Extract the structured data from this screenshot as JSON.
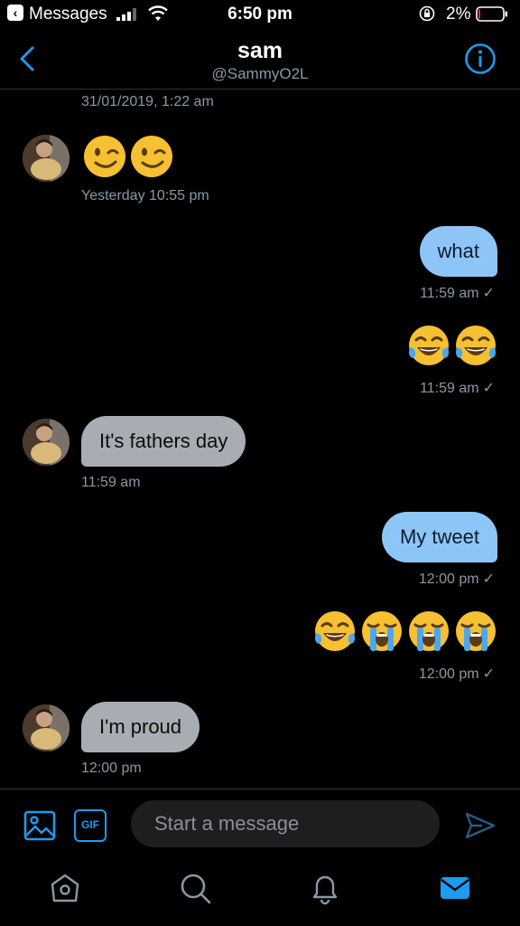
{
  "status_bar": {
    "back_app": "Messages",
    "time": "6:50 pm",
    "battery": "2%"
  },
  "header": {
    "name": "sam",
    "handle": "@SammyO2L"
  },
  "messages": [
    {
      "type": "meta",
      "text": "31/01/2019, 1:22 am"
    },
    {
      "type": "in",
      "content": "😉😉",
      "time": "Yesterday 10:55 pm"
    },
    {
      "type": "out",
      "content": "what",
      "time": "11:59 am"
    },
    {
      "type": "out",
      "content": "😂😂",
      "time": "11:59 am"
    },
    {
      "type": "in",
      "content": "It's fathers day",
      "time": "11:59 am"
    },
    {
      "type": "out",
      "content": "My tweet",
      "time": "12:00 pm"
    },
    {
      "type": "out",
      "content": "😂😭😭😭",
      "time": "12:00 pm"
    },
    {
      "type": "in",
      "content": "I'm proud",
      "time": "12:00 pm"
    }
  ],
  "composer": {
    "gif_label": "GIF",
    "placeholder": "Start a message"
  },
  "colors": {
    "accent": "#1d9bf0",
    "bubble_in": "#a8acb3",
    "bubble_out": "#8ec5f7",
    "background": "#000000"
  },
  "icons": {
    "tabs": [
      "home-icon",
      "search-icon",
      "notifications-icon",
      "messages-icon"
    ]
  }
}
